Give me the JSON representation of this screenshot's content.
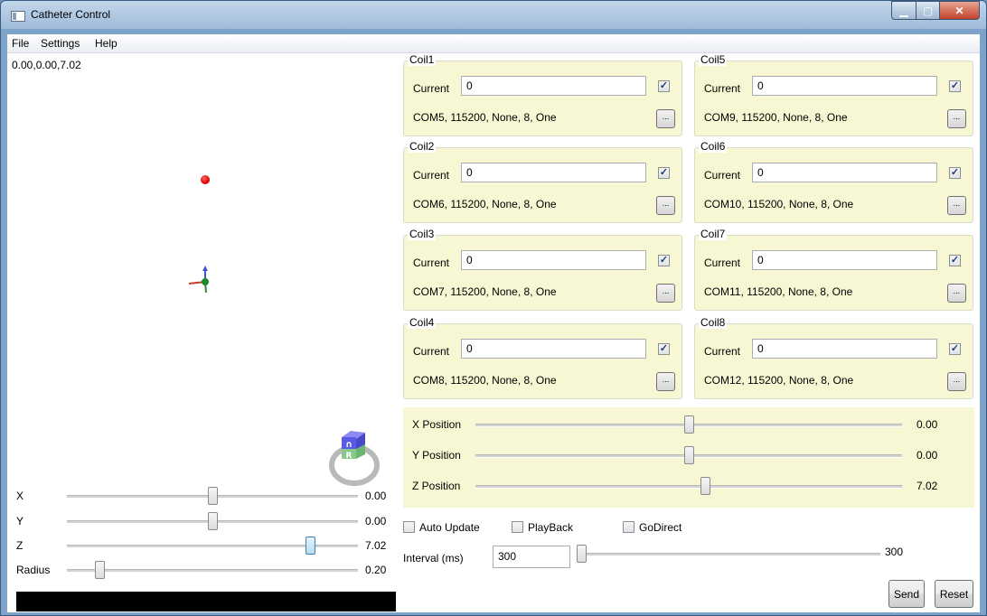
{
  "window": {
    "title": "Catheter Control"
  },
  "menu": {
    "file": "File",
    "settings": "Settings",
    "help": "Help"
  },
  "viewport": {
    "coords": "0.00,0.00,7.02",
    "cube_letter_top": "∩",
    "cube_letter_front": "R"
  },
  "left_sliders": [
    {
      "label": "X",
      "value": "0.00",
      "position": 0.5
    },
    {
      "label": "Y",
      "value": "0.00",
      "position": 0.5
    },
    {
      "label": "Z",
      "value": "7.02",
      "position": 0.85
    },
    {
      "label": "Radius",
      "value": "0.20",
      "position": 0.1
    }
  ],
  "coils": [
    {
      "name": "Coil1",
      "current_label": "Current",
      "current": "0",
      "checked": true,
      "port": "COM5, 115200, None, 8, One",
      "button": "..."
    },
    {
      "name": "Coil2",
      "current_label": "Current",
      "current": "0",
      "checked": true,
      "port": "COM6, 115200, None, 8, One",
      "button": "..."
    },
    {
      "name": "Coil3",
      "current_label": "Current",
      "current": "0",
      "checked": true,
      "port": "COM7, 115200, None, 8, One",
      "button": "..."
    },
    {
      "name": "Coil4",
      "current_label": "Current",
      "current": "0",
      "checked": true,
      "port": "COM8, 115200, None, 8, One",
      "button": "..."
    },
    {
      "name": "Coil5",
      "current_label": "Current",
      "current": "0",
      "checked": true,
      "port": "COM9, 115200, None, 8, One",
      "button": "..."
    },
    {
      "name": "Coil6",
      "current_label": "Current",
      "current": "0",
      "checked": true,
      "port": "COM10, 115200, None, 8, One",
      "button": "..."
    },
    {
      "name": "Coil7",
      "current_label": "Current",
      "current": "0",
      "checked": true,
      "port": "COM11, 115200, None, 8, One",
      "button": "..."
    },
    {
      "name": "Coil8",
      "current_label": "Current",
      "current": "0",
      "checked": true,
      "port": "COM12, 115200, None, 8, One",
      "button": "..."
    }
  ],
  "positions": [
    {
      "label": "X Position",
      "value": "0.00",
      "position": 0.5
    },
    {
      "label": "Y Position",
      "value": "0.00",
      "position": 0.5
    },
    {
      "label": "Z Position",
      "value": "7.02",
      "position": 0.54
    }
  ],
  "options": {
    "auto_update": "Auto Update",
    "playback": "PlayBack",
    "go_direct": "GoDirect"
  },
  "interval": {
    "label": "Interval (ms)",
    "value": "300",
    "display": "300",
    "position": 0.0
  },
  "buttons": {
    "send": "Send",
    "reset": "Reset"
  },
  "colors": {
    "panel": "#f7f7d4",
    "point": "#e00000"
  }
}
